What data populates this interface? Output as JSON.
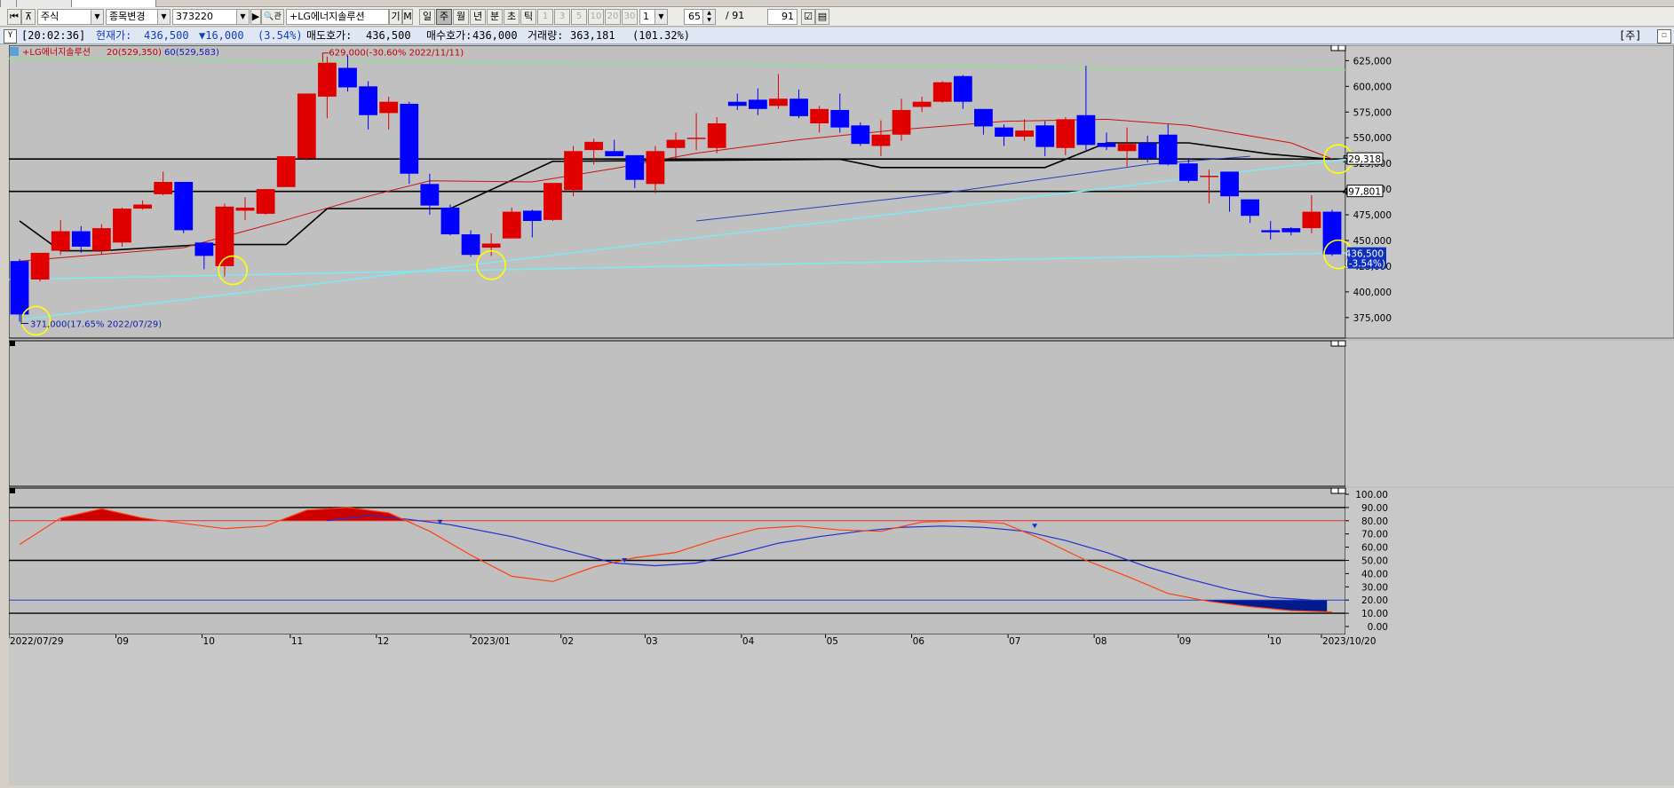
{
  "tab_strip": {
    "tabs": [
      "",
      "",
      ""
    ]
  },
  "toolbar": {
    "market_type": "주식",
    "change_item": "종목변경",
    "stock_code": "373220",
    "stock_name": "+LG에너지솔루션",
    "sub_btn": "기",
    "info_btn": "M",
    "periods": [
      {
        "label": "일",
        "active": false
      },
      {
        "label": "주",
        "active": true
      },
      {
        "label": "월",
        "active": false
      },
      {
        "label": "년",
        "active": false
      },
      {
        "label": "분",
        "active": false
      },
      {
        "label": "초",
        "active": false
      },
      {
        "label": "틱",
        "active": false
      }
    ],
    "intervals": [
      "1",
      "3",
      "5",
      "10",
      "20",
      "30"
    ],
    "interval_select": "1",
    "view_count": "65",
    "total_sep": "/ 91",
    "total_count": "91"
  },
  "info_bar": {
    "time": "[20:02:36]",
    "price_label": "현재가:",
    "price": "436,500",
    "change": "▼16,000",
    "change_pct": "(3.54%)",
    "ask_label": "매도호가:",
    "ask": "436,500",
    "bid_label": "매수호가:",
    "bid": "436,000",
    "vol_label": "거래량:",
    "volume": "363,181",
    "vol_pct": "(101.32%)",
    "right_label": "[주]"
  },
  "price_panel": {
    "legend_name": "+LG에너지솔루션",
    "legend_ma20": "20(529,350)",
    "legend_ma60": "60(529,583)",
    "high_annotation": "629,000(-30.60% 2022/11/11)",
    "low_annotation": "371,000(17.65% 2022/07/29)",
    "y_ticks": [
      "625,000",
      "600,000",
      "575,000",
      "550,000",
      "525,000",
      "500,000",
      "475,000",
      "450,000",
      "425,000",
      "400,000",
      "375,000"
    ],
    "hline_labels": [
      "529,318",
      "497,801"
    ],
    "last_price_label": "436,500",
    "last_change_label": "(-3.54%)"
  },
  "osc_panel": {
    "y_ticks": [
      "100.00",
      "90.00",
      "80.00",
      "70.00",
      "60.00",
      "50.00",
      "40.00",
      "30.00",
      "20.00",
      "10.00",
      "0.00"
    ]
  },
  "x_axis": {
    "labels": [
      "2022/07/29",
      "09",
      "10",
      "11",
      "12",
      "2023/01",
      "02",
      "03",
      "04",
      "05",
      "06",
      "07",
      "08",
      "09",
      "10",
      "2023/10/20"
    ]
  },
  "colors": {
    "up": "#e00000",
    "down": "#0000ff",
    "ma20": "#d01010",
    "ma60": "#2040c0",
    "baseline": "#000000",
    "trendline": "#7fe8f0",
    "resistance": "#88e888",
    "highlight_circle": "#ffff00",
    "osc_line_slow": "#2030d0",
    "osc_line_fast": "#ff4010",
    "osc_fill_high": "#cc0000",
    "osc_fill_low": "#001b8c"
  },
  "chart_data": {
    "type": "candlestick",
    "title": "+LG에너지솔루션",
    "interval": "weekly",
    "ylim": [
      355000,
      640000
    ],
    "candles": [
      {
        "o": 430000,
        "h": 432000,
        "l": 371000,
        "c": 378000
      },
      {
        "o": 412000,
        "h": 435000,
        "l": 410000,
        "c": 438000
      },
      {
        "o": 440000,
        "h": 470000,
        "l": 436000,
        "c": 459000
      },
      {
        "o": 459000,
        "h": 464000,
        "l": 438000,
        "c": 444000
      },
      {
        "o": 440000,
        "h": 466000,
        "l": 436000,
        "c": 462000
      },
      {
        "o": 448000,
        "h": 482000,
        "l": 444000,
        "c": 481000
      },
      {
        "o": 481000,
        "h": 489000,
        "l": 480000,
        "c": 485000
      },
      {
        "o": 495000,
        "h": 517000,
        "l": 494000,
        "c": 507000
      },
      {
        "o": 507000,
        "h": 506000,
        "l": 457000,
        "c": 460000
      },
      {
        "o": 448000,
        "h": 448000,
        "l": 422000,
        "c": 435000
      },
      {
        "o": 425000,
        "h": 486000,
        "l": 415000,
        "c": 483000
      },
      {
        "o": 479000,
        "h": 492000,
        "l": 470000,
        "c": 482000
      },
      {
        "o": 476000,
        "h": 500000,
        "l": 475000,
        "c": 500000
      },
      {
        "o": 502000,
        "h": 532000,
        "l": 502000,
        "c": 532000
      },
      {
        "o": 530000,
        "h": 593000,
        "l": 528000,
        "c": 593000
      },
      {
        "o": 590000,
        "h": 629000,
        "l": 569000,
        "c": 623000
      },
      {
        "o": 618000,
        "h": 630000,
        "l": 595000,
        "c": 599000
      },
      {
        "o": 600000,
        "h": 605000,
        "l": 558000,
        "c": 572000
      },
      {
        "o": 574000,
        "h": 590000,
        "l": 558000,
        "c": 585000
      },
      {
        "o": 583000,
        "h": 585000,
        "l": 505000,
        "c": 515000
      },
      {
        "o": 505000,
        "h": 515000,
        "l": 475000,
        "c": 484000
      },
      {
        "o": 482000,
        "h": 485000,
        "l": 455000,
        "c": 456000
      },
      {
        "o": 456000,
        "h": 460000,
        "l": 434000,
        "c": 436000
      },
      {
        "o": 443000,
        "h": 457000,
        "l": 435000,
        "c": 447000
      },
      {
        "o": 452000,
        "h": 482000,
        "l": 452000,
        "c": 478000
      },
      {
        "o": 479000,
        "h": 480000,
        "l": 453000,
        "c": 469000
      },
      {
        "o": 470000,
        "h": 505000,
        "l": 469000,
        "c": 506000
      },
      {
        "o": 499000,
        "h": 542000,
        "l": 493000,
        "c": 537000
      },
      {
        "o": 538000,
        "h": 549000,
        "l": 524000,
        "c": 546000
      },
      {
        "o": 537000,
        "h": 548000,
        "l": 536000,
        "c": 532000
      },
      {
        "o": 533000,
        "h": 533000,
        "l": 501000,
        "c": 509000
      },
      {
        "o": 505000,
        "h": 542000,
        "l": 496000,
        "c": 537000
      },
      {
        "o": 540000,
        "h": 555000,
        "l": 530000,
        "c": 548000
      },
      {
        "o": 550000,
        "h": 574000,
        "l": 538000,
        "c": 550000
      },
      {
        "o": 540000,
        "h": 570000,
        "l": 535000,
        "c": 564000
      },
      {
        "o": 585000,
        "h": 593000,
        "l": 577000,
        "c": 581000
      },
      {
        "o": 587000,
        "h": 598000,
        "l": 572000,
        "c": 578000
      },
      {
        "o": 581000,
        "h": 612000,
        "l": 578000,
        "c": 588000
      },
      {
        "o": 588000,
        "h": 597000,
        "l": 569000,
        "c": 571000
      },
      {
        "o": 564000,
        "h": 581000,
        "l": 555000,
        "c": 578000
      },
      {
        "o": 577000,
        "h": 593000,
        "l": 555000,
        "c": 560000
      },
      {
        "o": 562000,
        "h": 565000,
        "l": 542000,
        "c": 544000
      },
      {
        "o": 542000,
        "h": 567000,
        "l": 532000,
        "c": 553000
      },
      {
        "o": 553000,
        "h": 588000,
        "l": 547000,
        "c": 577000
      },
      {
        "o": 580000,
        "h": 590000,
        "l": 575000,
        "c": 585000
      },
      {
        "o": 585000,
        "h": 605000,
        "l": 584000,
        "c": 604000
      },
      {
        "o": 610000,
        "h": 611000,
        "l": 578000,
        "c": 585000
      },
      {
        "o": 578000,
        "h": 578000,
        "l": 553000,
        "c": 561000
      },
      {
        "o": 560000,
        "h": 563000,
        "l": 542000,
        "c": 551000
      },
      {
        "o": 551000,
        "h": 568000,
        "l": 547000,
        "c": 557000
      },
      {
        "o": 562000,
        "h": 566000,
        "l": 532000,
        "c": 541000
      },
      {
        "o": 540000,
        "h": 570000,
        "l": 533000,
        "c": 568000
      },
      {
        "o": 572000,
        "h": 620000,
        "l": 538000,
        "c": 543000
      },
      {
        "o": 545000,
        "h": 555000,
        "l": 538000,
        "c": 541000
      },
      {
        "o": 537000,
        "h": 560000,
        "l": 522000,
        "c": 544000
      },
      {
        "o": 545000,
        "h": 552000,
        "l": 526000,
        "c": 530000
      },
      {
        "o": 553000,
        "h": 563000,
        "l": 523000,
        "c": 524000
      },
      {
        "o": 525000,
        "h": 530000,
        "l": 506000,
        "c": 508000
      },
      {
        "o": 512000,
        "h": 519000,
        "l": 486000,
        "c": 513000
      },
      {
        "o": 517000,
        "h": 517000,
        "l": 478000,
        "c": 493000
      },
      {
        "o": 490000,
        "h": 490000,
        "l": 467000,
        "c": 474000
      },
      {
        "o": 460000,
        "h": 469000,
        "l": 451000,
        "c": 458000
      },
      {
        "o": 462000,
        "h": 463000,
        "l": 455000,
        "c": 458000
      },
      {
        "o": 462000,
        "h": 494000,
        "l": 457000,
        "c": 478000
      },
      {
        "o": 478000,
        "h": 480000,
        "l": 435000,
        "c": 436500
      }
    ],
    "horizontal_levels": [
      529318,
      497801
    ],
    "ma20": [
      [
        0,
        430000
      ],
      [
        8,
        443000
      ],
      [
        13,
        470000
      ],
      [
        17,
        493000
      ],
      [
        20,
        508000
      ],
      [
        25,
        507000
      ],
      [
        29,
        520000
      ],
      [
        33,
        535000
      ],
      [
        38,
        548000
      ],
      [
        43,
        558000
      ],
      [
        48,
        566000
      ],
      [
        53,
        568000
      ],
      [
        57,
        562000
      ],
      [
        62,
        545000
      ],
      [
        64,
        529350
      ]
    ],
    "ma60": [
      [
        33,
        469000
      ],
      [
        45,
        496000
      ],
      [
        55,
        524000
      ],
      [
        60,
        532000
      ]
    ],
    "baseline": [
      [
        0,
        469000
      ],
      [
        2,
        440000
      ],
      [
        4,
        440000
      ],
      [
        9,
        446000
      ],
      [
        13,
        446000
      ],
      [
        15,
        481000
      ],
      [
        21,
        481000
      ],
      [
        26,
        527000
      ],
      [
        40,
        529000
      ],
      [
        42,
        521000
      ],
      [
        50,
        521000
      ],
      [
        53,
        545000
      ],
      [
        57,
        545000
      ],
      [
        61,
        534000
      ],
      [
        64,
        529000
      ]
    ],
    "oscillator": {
      "ylim": [
        0,
        100
      ],
      "levels": [
        90,
        80,
        50,
        20,
        10
      ],
      "fast": [
        [
          0,
          62
        ],
        [
          2,
          82
        ],
        [
          4,
          89
        ],
        [
          6,
          82
        ],
        [
          8,
          78
        ],
        [
          10,
          74
        ],
        [
          12,
          76
        ],
        [
          14,
          88
        ],
        [
          16,
          90
        ],
        [
          18,
          86
        ],
        [
          20,
          72
        ],
        [
          22,
          54
        ],
        [
          24,
          38
        ],
        [
          26,
          34
        ],
        [
          28,
          45
        ],
        [
          30,
          52
        ],
        [
          32,
          56
        ],
        [
          34,
          66
        ],
        [
          36,
          74
        ],
        [
          38,
          76
        ],
        [
          40,
          73
        ],
        [
          42,
          72
        ],
        [
          44,
          79
        ],
        [
          46,
          80
        ],
        [
          48,
          78
        ],
        [
          50,
          65
        ],
        [
          52,
          50
        ],
        [
          54,
          38
        ],
        [
          56,
          25
        ],
        [
          58,
          19
        ],
        [
          60,
          15
        ],
        [
          62,
          12
        ],
        [
          64,
          11
        ]
      ],
      "slow": [
        [
          15,
          80
        ],
        [
          17,
          84
        ],
        [
          19,
          81
        ],
        [
          21,
          77
        ],
        [
          24,
          68
        ],
        [
          27,
          56
        ],
        [
          29,
          48
        ],
        [
          31,
          46
        ],
        [
          33,
          48
        ],
        [
          35,
          55
        ],
        [
          37,
          63
        ],
        [
          39,
          68
        ],
        [
          41,
          72
        ],
        [
          43,
          75
        ],
        [
          45,
          76
        ],
        [
          47,
          75
        ],
        [
          49,
          72
        ],
        [
          51,
          65
        ],
        [
          53,
          56
        ],
        [
          55,
          45
        ],
        [
          57,
          36
        ],
        [
          59,
          28
        ],
        [
          61,
          22
        ],
        [
          63,
          20
        ]
      ]
    }
  }
}
